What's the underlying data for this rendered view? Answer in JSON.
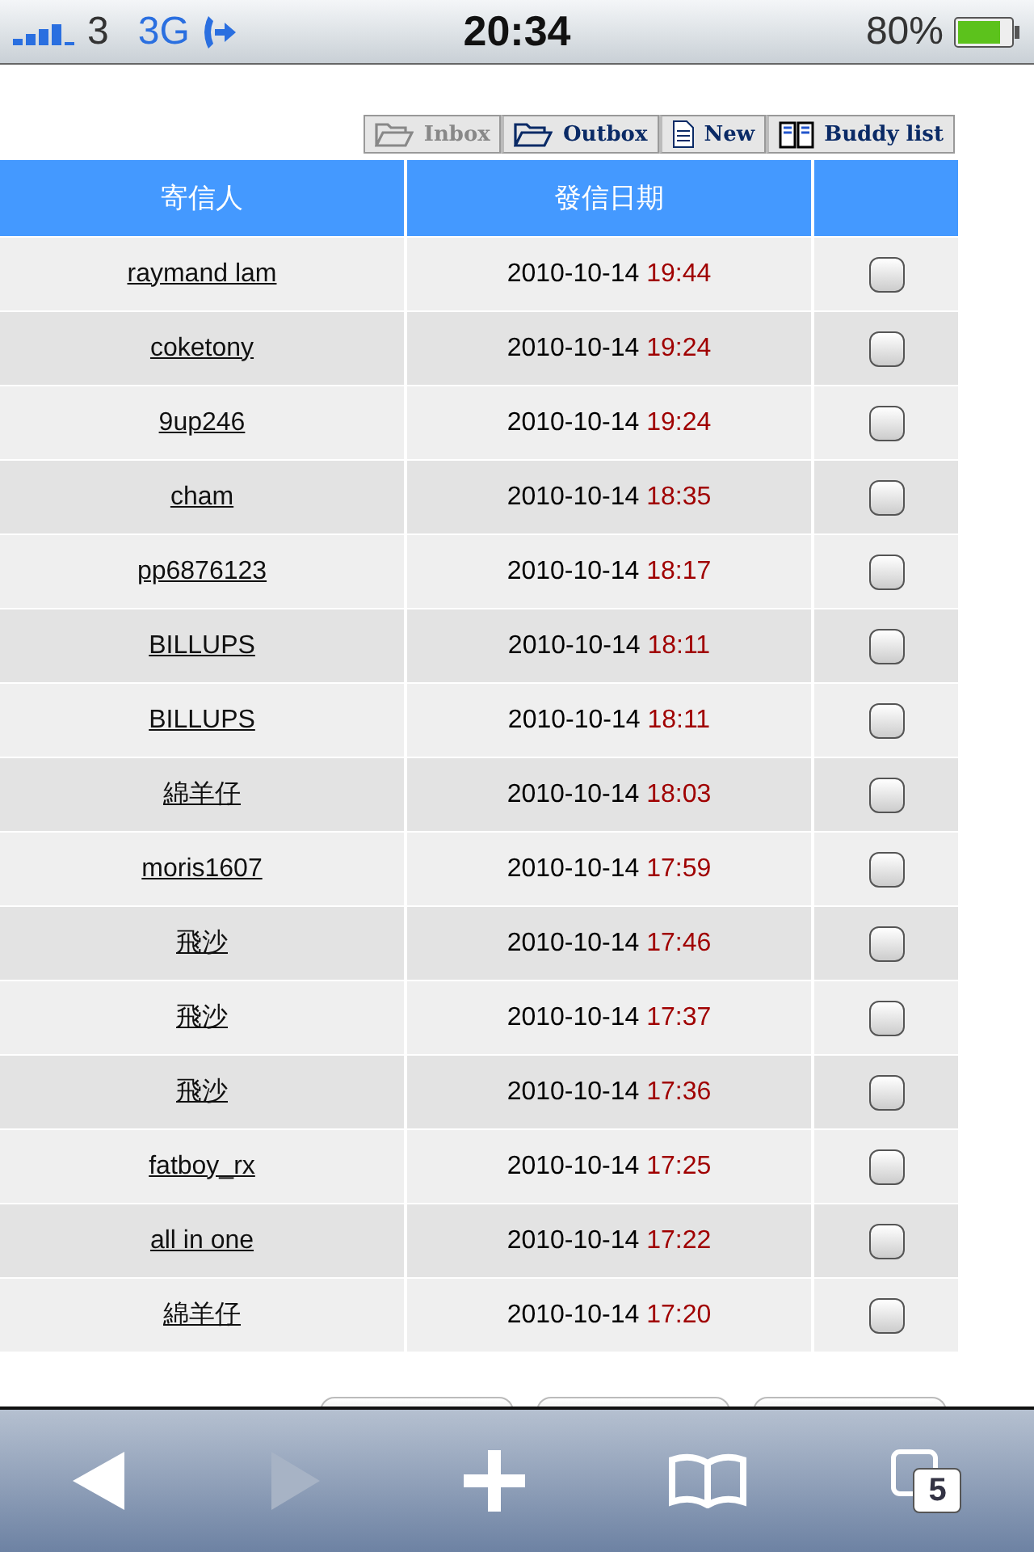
{
  "status_bar": {
    "carrier": "3",
    "network": "3G",
    "time": "20:34",
    "battery": "80%"
  },
  "mail_tabs": [
    {
      "label": "Inbox",
      "kind": "folder",
      "selected": true
    },
    {
      "label": "Outbox",
      "kind": "folder",
      "selected": false
    },
    {
      "label": "New",
      "kind": "page",
      "selected": false
    },
    {
      "label": "Buddy list",
      "kind": "book",
      "selected": false
    }
  ],
  "table": {
    "columns": [
      "寄信人",
      "發信日期"
    ],
    "rows": [
      {
        "sender": "raymand lam ",
        "date": "2010-10-14",
        "time": "19:44",
        "checked": false
      },
      {
        "sender": "coketony",
        "date": "2010-10-14",
        "time": "19:24",
        "checked": false
      },
      {
        "sender": "9up246",
        "date": "2010-10-14",
        "time": "19:24",
        "checked": false
      },
      {
        "sender": "cham",
        "date": "2010-10-14",
        "time": "18:35",
        "checked": false
      },
      {
        "sender": "pp6876123 ",
        "date": "2010-10-14",
        "time": "18:17",
        "checked": false
      },
      {
        "sender": "BILLUPS",
        "date": "2010-10-14",
        "time": "18:11",
        "checked": false
      },
      {
        "sender": "BILLUPS",
        "date": "2010-10-14",
        "time": "18:11",
        "checked": false
      },
      {
        "sender": "綿羊仔",
        "date": "2010-10-14",
        "time": "18:03",
        "checked": false
      },
      {
        "sender": "moris1607 ",
        "date": "2010-10-14",
        "time": "17:59",
        "checked": false
      },
      {
        "sender": "飛沙",
        "date": "2010-10-14",
        "time": "17:46",
        "checked": false
      },
      {
        "sender": "飛沙",
        "date": "2010-10-14",
        "time": "17:37",
        "checked": false
      },
      {
        "sender": "飛沙",
        "date": "2010-10-14",
        "time": "17:36",
        "checked": false
      },
      {
        "sender": "fatboy_rx",
        "date": "2010-10-14",
        "time": "17:25",
        "checked": false
      },
      {
        "sender": "all in one",
        "date": "2010-10-14",
        "time": "17:22",
        "checked": false
      },
      {
        "sender": "綿羊仔",
        "date": "2010-10-14",
        "time": "17:20",
        "checked": false
      }
    ]
  },
  "browser_toolbar": {
    "back_enabled": true,
    "forward_enabled": false,
    "pages": "5"
  }
}
